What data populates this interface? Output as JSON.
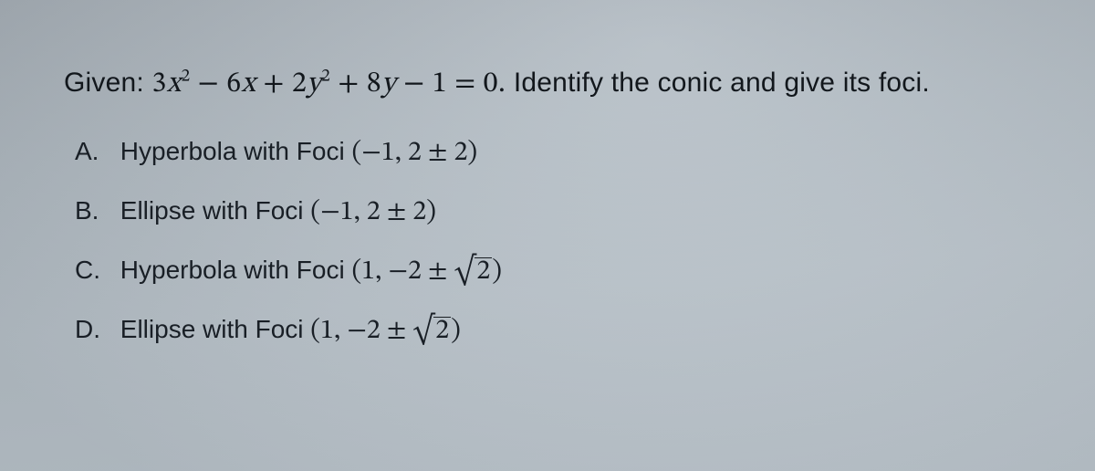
{
  "question": {
    "lead": "Given: ",
    "equation_html": "3<i>x</i><sup>2</sup> − 6<i>x</i> + 2<i>y</i><sup>2</sup> + 8<i>y</i> − 1 = 0.",
    "tail": " Identify the conic and give its foci."
  },
  "options": [
    {
      "marker": "A.",
      "label": "Hyperbola",
      "middle": " with Foci ",
      "foci_html": "(−1, 2 ± 2)"
    },
    {
      "marker": "B.",
      "label": "Ellipse",
      "middle": " with Foci ",
      "foci_html": "(−1, 2 ± 2)"
    },
    {
      "marker": "C.",
      "label": "Hyperbola",
      "middle": " with Foci ",
      "foci_html": "(1, −2 ± <span class=\"sqrt\"><span>2</span></span>)"
    },
    {
      "marker": "D.",
      "label": "Ellipse",
      "middle": " with Foci ",
      "foci_html": "(1, −2 ± <span class=\"sqrt\"><span>2</span></span>)"
    }
  ]
}
